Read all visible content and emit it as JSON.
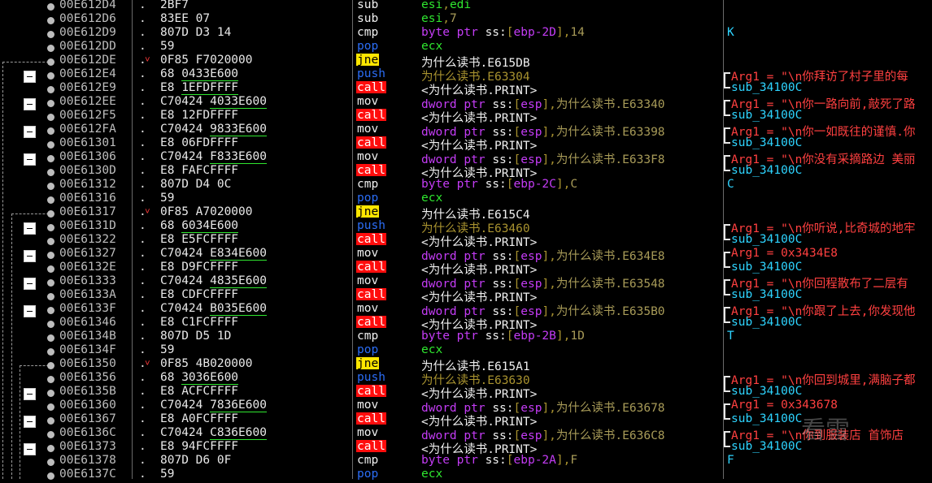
{
  "rows": [
    {
      "addr": "00E612D4",
      "bytes": "2BF7",
      "mnem": "sub",
      "mtype": "std",
      "ops": [
        {
          "t": "esi",
          "c": "reg"
        },
        {
          "t": ",",
          "c": "dim"
        },
        {
          "t": "edi",
          "c": "reg"
        }
      ],
      "comment": ""
    },
    {
      "addr": "00E612D6",
      "bytes": "83EE 07",
      "mnem": "sub",
      "mtype": "std",
      "ops": [
        {
          "t": "esi",
          "c": "reg"
        },
        {
          "t": ",",
          "c": "dim"
        },
        {
          "t": "7",
          "c": "num"
        }
      ],
      "comment": ""
    },
    {
      "addr": "00E612D9",
      "bytes": "807D D3 14",
      "mnem": "cmp",
      "mtype": "std",
      "ops": [
        {
          "t": "byte ptr ",
          "c": "kw"
        },
        {
          "t": "ss:",
          "c": "seg"
        },
        {
          "t": "[",
          "c": "dim"
        },
        {
          "t": "ebp-2D",
          "c": "kw"
        },
        {
          "t": "],",
          "c": "dim"
        },
        {
          "t": "14",
          "c": "num"
        }
      ],
      "comment": "K",
      "ctype": "cyan"
    },
    {
      "addr": "00E612DD",
      "bytes": "59",
      "mnem": "pop",
      "mtype": "pop",
      "ops": [
        {
          "t": "ecx",
          "c": "reg"
        }
      ],
      "comment": ""
    },
    {
      "addr": "00E612DE",
      "bytes": "0F85 F7020000",
      "mnem": "jne",
      "mtype": "jne",
      "ops": [
        {
          "t": "为什么读书.E615DB",
          "c": "str"
        }
      ],
      "comment": "",
      "jump": true
    },
    {
      "addr": "00E612E4",
      "bytes": "68 ",
      "ul": "0433E600",
      "mnem": "push",
      "mtype": "push",
      "ops": [
        {
          "t": "为什么读书.E63304",
          "c": "dim"
        }
      ],
      "comment": "Arg1 = \"\\n你拜访了村子里的每",
      "ctype": "arg"
    },
    {
      "addr": "00E612E9",
      "bytes": "E8 ",
      "ul": "1EFDFFFF",
      "mnem": "call",
      "mtype": "call",
      "ops": [
        {
          "t": "<为什么读书.PRINT>",
          "c": "str"
        }
      ],
      "comment": "sub_34100C",
      "ctype": "sub"
    },
    {
      "addr": "00E612EE",
      "bytes": "C70424 ",
      "ul": "4033E600",
      "mnem": "mov",
      "mtype": "mov",
      "ops": [
        {
          "t": "dword ptr ",
          "c": "kw"
        },
        {
          "t": "ss:",
          "c": "seg"
        },
        {
          "t": "[",
          "c": "dim"
        },
        {
          "t": "esp",
          "c": "kw"
        },
        {
          "t": "],",
          "c": "dim"
        },
        {
          "t": "为什么读书.E63340",
          "c": "num"
        }
      ],
      "comment": "Arg1 = \"\\n你一路向前,敲死了路",
      "ctype": "arg"
    },
    {
      "addr": "00E612F5",
      "bytes": "E8 12FDFFFF",
      "mnem": "call",
      "mtype": "call",
      "ops": [
        {
          "t": "<为什么读书.PRINT>",
          "c": "str"
        }
      ],
      "comment": "sub_34100C",
      "ctype": "sub"
    },
    {
      "addr": "00E612FA",
      "bytes": "C70424 ",
      "ul": "9833E600",
      "mnem": "mov",
      "mtype": "mov",
      "ops": [
        {
          "t": "dword ptr ",
          "c": "kw"
        },
        {
          "t": "ss:",
          "c": "seg"
        },
        {
          "t": "[",
          "c": "dim"
        },
        {
          "t": "esp",
          "c": "kw"
        },
        {
          "t": "],",
          "c": "dim"
        },
        {
          "t": "为什么读书.E63398",
          "c": "num"
        }
      ],
      "comment": "Arg1 = \"\\n你一如既往的谨慎.你",
      "ctype": "arg"
    },
    {
      "addr": "00E61301",
      "bytes": "E8 06FDFFFF",
      "mnem": "call",
      "mtype": "call",
      "ops": [
        {
          "t": "<为什么读书.PRINT>",
          "c": "str"
        }
      ],
      "comment": "sub_34100C",
      "ctype": "sub"
    },
    {
      "addr": "00E61306",
      "bytes": "C70424 ",
      "ul": "F833E600",
      "mnem": "mov",
      "mtype": "mov",
      "ops": [
        {
          "t": "dword ptr ",
          "c": "kw"
        },
        {
          "t": "ss:",
          "c": "seg"
        },
        {
          "t": "[",
          "c": "dim"
        },
        {
          "t": "esp",
          "c": "kw"
        },
        {
          "t": "],",
          "c": "dim"
        },
        {
          "t": "为什么读书.E633F8",
          "c": "num"
        }
      ],
      "comment": "Arg1 = \"\\n你没有采摘路边 美丽",
      "ctype": "arg"
    },
    {
      "addr": "00E6130D",
      "bytes": "E8 FAFCFFFF",
      "mnem": "call",
      "mtype": "call",
      "ops": [
        {
          "t": "<为什么读书.PRINT>",
          "c": "str"
        }
      ],
      "comment": "sub_34100C",
      "ctype": "sub"
    },
    {
      "addr": "00E61312",
      "bytes": "807D D4 0C",
      "mnem": "cmp",
      "mtype": "std",
      "ops": [
        {
          "t": "byte ptr ",
          "c": "kw"
        },
        {
          "t": "ss:",
          "c": "seg"
        },
        {
          "t": "[",
          "c": "dim"
        },
        {
          "t": "ebp-2C",
          "c": "kw"
        },
        {
          "t": "],",
          "c": "dim"
        },
        {
          "t": "C",
          "c": "num"
        }
      ],
      "comment": "C",
      "ctype": "cyan"
    },
    {
      "addr": "00E61316",
      "bytes": "59",
      "mnem": "pop",
      "mtype": "pop",
      "ops": [
        {
          "t": "ecx",
          "c": "reg"
        }
      ],
      "comment": ""
    },
    {
      "addr": "00E61317",
      "bytes": "0F85 A7020000",
      "mnem": "jne",
      "mtype": "jne",
      "ops": [
        {
          "t": "为什么读书.E615C4",
          "c": "str"
        }
      ],
      "comment": "",
      "jump": true
    },
    {
      "addr": "00E6131D",
      "bytes": "68 ",
      "ul": "6034E600",
      "mnem": "push",
      "mtype": "push",
      "ops": [
        {
          "t": "为什么读书.E63460",
          "c": "dim"
        }
      ],
      "comment": "Arg1 = \"\\n你听说,比奇城的地牢",
      "ctype": "arg"
    },
    {
      "addr": "00E61322",
      "bytes": "E8 E5FCFFFF",
      "mnem": "call",
      "mtype": "call",
      "ops": [
        {
          "t": "<为什么读书.PRINT>",
          "c": "str"
        }
      ],
      "comment": "sub_34100C",
      "ctype": "sub"
    },
    {
      "addr": "00E61327",
      "bytes": "C70424 ",
      "ul": "E834E600",
      "mnem": "mov",
      "mtype": "mov",
      "ops": [
        {
          "t": "dword ptr ",
          "c": "kw"
        },
        {
          "t": "ss:",
          "c": "seg"
        },
        {
          "t": "[",
          "c": "dim"
        },
        {
          "t": "esp",
          "c": "kw"
        },
        {
          "t": "],",
          "c": "dim"
        },
        {
          "t": "为什么读书.E634E8",
          "c": "num"
        }
      ],
      "comment": "Arg1 = 0x3434E8",
      "ctype": "arg"
    },
    {
      "addr": "00E6132E",
      "bytes": "E8 D9FCFFFF",
      "mnem": "call",
      "mtype": "call",
      "ops": [
        {
          "t": "<为什么读书.PRINT>",
          "c": "str"
        }
      ],
      "comment": "sub_34100C",
      "ctype": "sub"
    },
    {
      "addr": "00E61333",
      "bytes": "C70424 ",
      "ul": "4835E600",
      "mnem": "mov",
      "mtype": "mov",
      "ops": [
        {
          "t": "dword ptr ",
          "c": "kw"
        },
        {
          "t": "ss:",
          "c": "seg"
        },
        {
          "t": "[",
          "c": "dim"
        },
        {
          "t": "esp",
          "c": "kw"
        },
        {
          "t": "],",
          "c": "dim"
        },
        {
          "t": "为什么读书.E63548",
          "c": "num"
        }
      ],
      "comment": "Arg1 = \"\\n你回程散布了二层有",
      "ctype": "arg"
    },
    {
      "addr": "00E6133A",
      "bytes": "E8 CDFCFFFF",
      "mnem": "call",
      "mtype": "call",
      "ops": [
        {
          "t": "<为什么读书.PRINT>",
          "c": "str"
        }
      ],
      "comment": "sub_34100C",
      "ctype": "sub"
    },
    {
      "addr": "00E6133F",
      "bytes": "C70424 ",
      "ul": "B035E600",
      "mnem": "mov",
      "mtype": "mov",
      "ops": [
        {
          "t": "dword ptr ",
          "c": "kw"
        },
        {
          "t": "ss:",
          "c": "seg"
        },
        {
          "t": "[",
          "c": "dim"
        },
        {
          "t": "esp",
          "c": "kw"
        },
        {
          "t": "],",
          "c": "dim"
        },
        {
          "t": "为什么读书.E635B0",
          "c": "num"
        }
      ],
      "comment": "Arg1 = \"\\n你跟了上去,你发现他",
      "ctype": "arg"
    },
    {
      "addr": "00E61346",
      "bytes": "E8 C1FCFFFF",
      "mnem": "call",
      "mtype": "call",
      "ops": [
        {
          "t": "<为什么读书.PRINT>",
          "c": "str"
        }
      ],
      "comment": "sub_34100C",
      "ctype": "sub"
    },
    {
      "addr": "00E6134B",
      "bytes": "807D D5 1D",
      "mnem": "cmp",
      "mtype": "std",
      "ops": [
        {
          "t": "byte ptr ",
          "c": "kw"
        },
        {
          "t": "ss:",
          "c": "seg"
        },
        {
          "t": "[",
          "c": "dim"
        },
        {
          "t": "ebp-2B",
          "c": "kw"
        },
        {
          "t": "],",
          "c": "dim"
        },
        {
          "t": "1D",
          "c": "num"
        }
      ],
      "comment": "T",
      "ctype": "cyan"
    },
    {
      "addr": "00E6134F",
      "bytes": "59",
      "mnem": "pop",
      "mtype": "pop",
      "ops": [
        {
          "t": "ecx",
          "c": "reg"
        }
      ],
      "comment": ""
    },
    {
      "addr": "00E61350",
      "bytes": "0F85 4B020000",
      "mnem": "jne",
      "mtype": "jne",
      "ops": [
        {
          "t": "为什么读书.E615A1",
          "c": "str"
        }
      ],
      "comment": "",
      "jump": true
    },
    {
      "addr": "00E61356",
      "bytes": "68 ",
      "ul": "3036E600",
      "mnem": "push",
      "mtype": "push",
      "ops": [
        {
          "t": "为什么读书.E63630",
          "c": "dim"
        }
      ],
      "comment": "Arg1 = \"\\n你回到城里,满脑子都",
      "ctype": "arg"
    },
    {
      "addr": "00E6135B",
      "bytes": "E8 ACFCFFFF",
      "mnem": "call",
      "mtype": "call",
      "ops": [
        {
          "t": "<为什么读书.PRINT>",
          "c": "str"
        }
      ],
      "comment": "sub_34100C",
      "ctype": "sub"
    },
    {
      "addr": "00E61360",
      "bytes": "C70424 ",
      "ul": "7836E600",
      "mnem": "mov",
      "mtype": "mov",
      "ops": [
        {
          "t": "dword ptr ",
          "c": "kw"
        },
        {
          "t": "ss:",
          "c": "seg"
        },
        {
          "t": "[",
          "c": "dim"
        },
        {
          "t": "esp",
          "c": "kw"
        },
        {
          "t": "],",
          "c": "dim"
        },
        {
          "t": "为什么读书.E63678",
          "c": "num"
        }
      ],
      "comment": "Arg1 = 0x343678",
      "ctype": "arg"
    },
    {
      "addr": "00E61367",
      "bytes": "E8 A0FCFFFF",
      "mnem": "call",
      "mtype": "call",
      "ops": [
        {
          "t": "<为什么读书.PRINT>",
          "c": "str"
        }
      ],
      "comment": "sub_34100C",
      "ctype": "sub"
    },
    {
      "addr": "00E6136C",
      "bytes": "C70424 ",
      "ul": "C836E600",
      "mnem": "mov",
      "mtype": "mov",
      "ops": [
        {
          "t": "dword ptr ",
          "c": "kw"
        },
        {
          "t": "ss:",
          "c": "seg"
        },
        {
          "t": "[",
          "c": "dim"
        },
        {
          "t": "esp",
          "c": "kw"
        },
        {
          "t": "],",
          "c": "dim"
        },
        {
          "t": "为什么读书.E636C8",
          "c": "num"
        }
      ],
      "comment": "Arg1 = \"\\n你到服装店 首饰店",
      "ctype": "arg"
    },
    {
      "addr": "00E61373",
      "bytes": "E8 94FCFFFF",
      "mnem": "call",
      "mtype": "call",
      "ops": [
        {
          "t": "<为什么读书.PRINT>",
          "c": "str"
        }
      ],
      "comment": "sub_34100C",
      "ctype": "sub"
    },
    {
      "addr": "00E61378",
      "bytes": "807D D6 0F",
      "mnem": "cmp",
      "mtype": "std",
      "ops": [
        {
          "t": "byte ptr ",
          "c": "kw"
        },
        {
          "t": "ss:",
          "c": "seg"
        },
        {
          "t": "[",
          "c": "dim"
        },
        {
          "t": "ebp-2A",
          "c": "kw"
        },
        {
          "t": "],",
          "c": "dim"
        },
        {
          "t": "F",
          "c": "num"
        }
      ],
      "comment": "F",
      "ctype": "cyan"
    },
    {
      "addr": "00E6137C",
      "bytes": "59",
      "mnem": "pop",
      "mtype": "pop",
      "ops": [
        {
          "t": "ecx",
          "c": "reg"
        }
      ],
      "comment": ""
    }
  ],
  "watermark": "看雪",
  "colors": {
    "background": "#000000",
    "reg": "#2fe62f",
    "keyword": "#c43cf5",
    "call_bg": "#ff0d0d",
    "jne_bg": "#ffe600",
    "pop": "#2b6df5",
    "comment_arg": "#ff4040",
    "comment_sub": "#2ed4ff"
  }
}
